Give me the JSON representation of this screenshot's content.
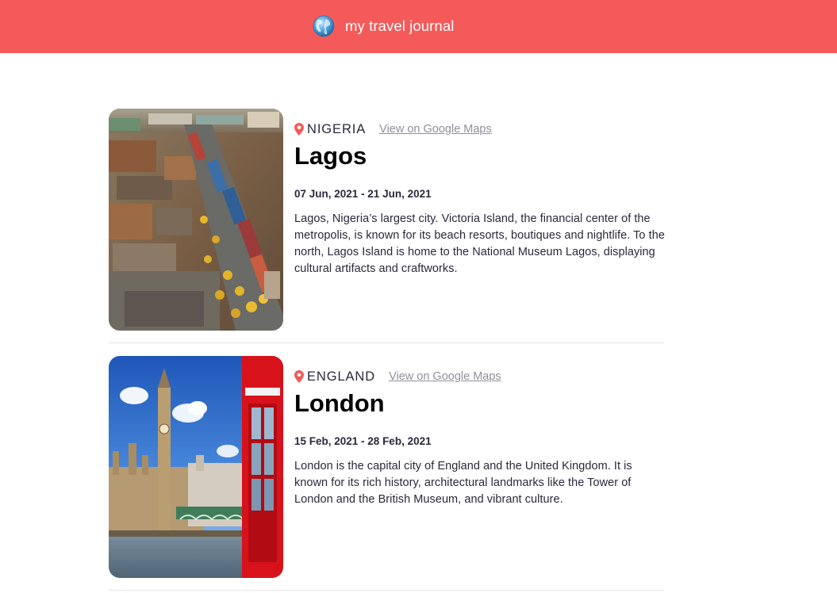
{
  "header": {
    "title": "my travel journal",
    "icon": "globe-icon",
    "background": "#f55a5a"
  },
  "entries": [
    {
      "image": "lagos-market-photo",
      "country": "NIGERIA",
      "maps_link": "View on Google Maps",
      "title": "Lagos",
      "dates": "07 Jun, 2021 - 21 Jun, 2021",
      "description": "Lagos, Nigeria’s largest city. Victoria Island, the financial center of the metropolis, is known for its beach resorts, boutiques and nightlife. To the north, Lagos Island is home to the National Museum Lagos, displaying cultural artifacts and craftworks."
    },
    {
      "image": "london-big-ben-phone-box-photo",
      "country": "ENGLAND",
      "maps_link": "View on Google Maps",
      "title": "London",
      "dates": "15 Feb, 2021 - 28 Feb, 2021",
      "description": "London is the capital city of England and the United Kingdom. It is known for its rich history, architectural landmarks like the Tower of London and the British Museum, and vibrant culture."
    }
  ],
  "colors": {
    "accent": "#f55a5a",
    "link": "#918e9b",
    "text": "#2b283a",
    "divider": "#e5e5e5"
  }
}
